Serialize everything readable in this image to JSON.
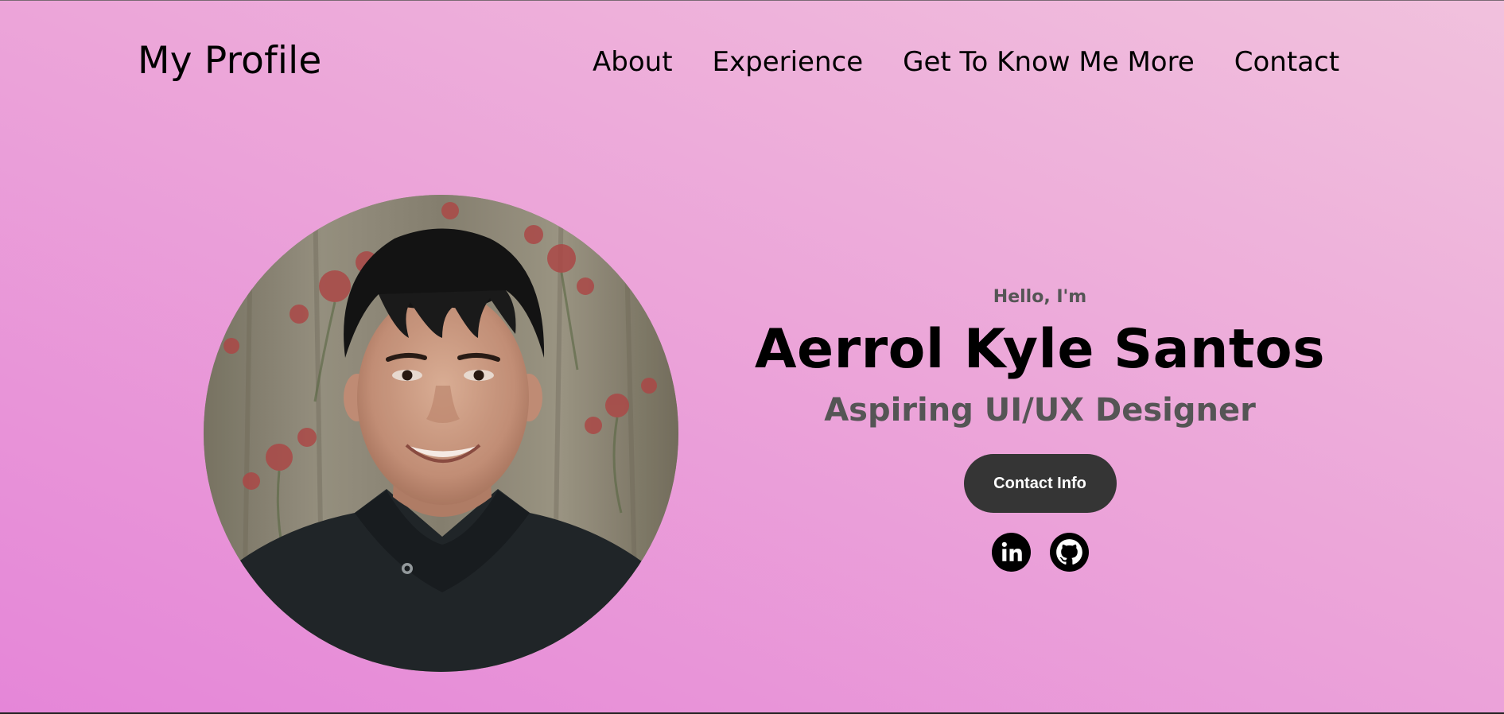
{
  "nav": {
    "logo": "My Profile",
    "links": [
      "About",
      "Experience",
      "Get To Know Me More",
      "Contact"
    ]
  },
  "hero": {
    "greeting": "Hello, I'm",
    "name": "Aerrol Kyle Santos",
    "role": "Aspiring UI/UX Designer",
    "button_label": "Contact Info",
    "socials": [
      {
        "icon": "linkedin-icon"
      },
      {
        "icon": "github-icon"
      }
    ]
  },
  "colors": {
    "bg_top_right": "#f1c1dd",
    "bg_bottom_left": "#e586d8",
    "button_bg": "#353535",
    "muted_text": "#555555"
  }
}
